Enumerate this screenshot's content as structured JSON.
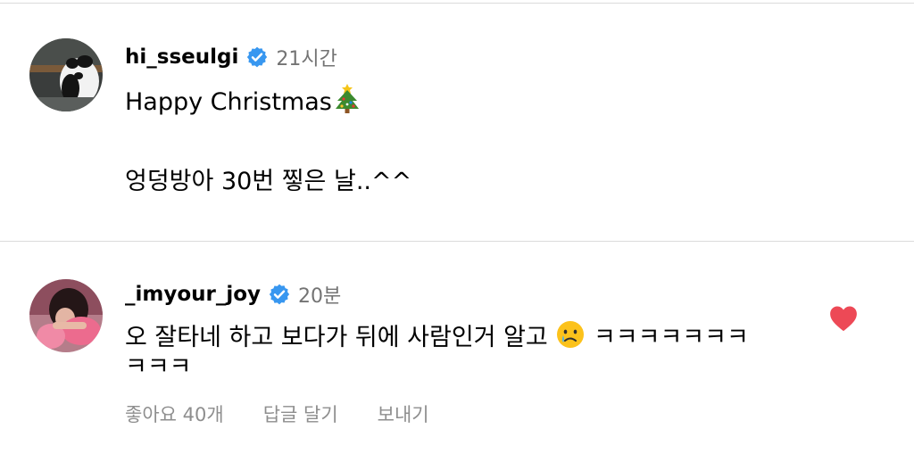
{
  "comments": [
    {
      "username": "hi_sseulgi",
      "timestamp": "21시간",
      "line1": "Happy Christmas",
      "line1_emoji": "christmas-tree-emoji",
      "line2": "엉덩방아 30번 찧은 날..^^"
    },
    {
      "username": "_imyour_joy",
      "timestamp": "20분",
      "line1_start": "오 잘타네 하고 보다가 뒤에 사람인거 알고 ",
      "line1_emoji": "crying-face-emoji",
      "line1_end": " ㅋㅋㅋㅋㅋㅋㅋ",
      "line2": "ㅋㅋㅋ",
      "liked": true,
      "actions": {
        "likes": "좋아요 40개",
        "reply": "답글 달기",
        "send": "보내기"
      }
    }
  ],
  "colors": {
    "verified": "#3897f0",
    "heart": "#ed4956",
    "secondary_text": "#737373",
    "divider": "#dbdbdb"
  }
}
